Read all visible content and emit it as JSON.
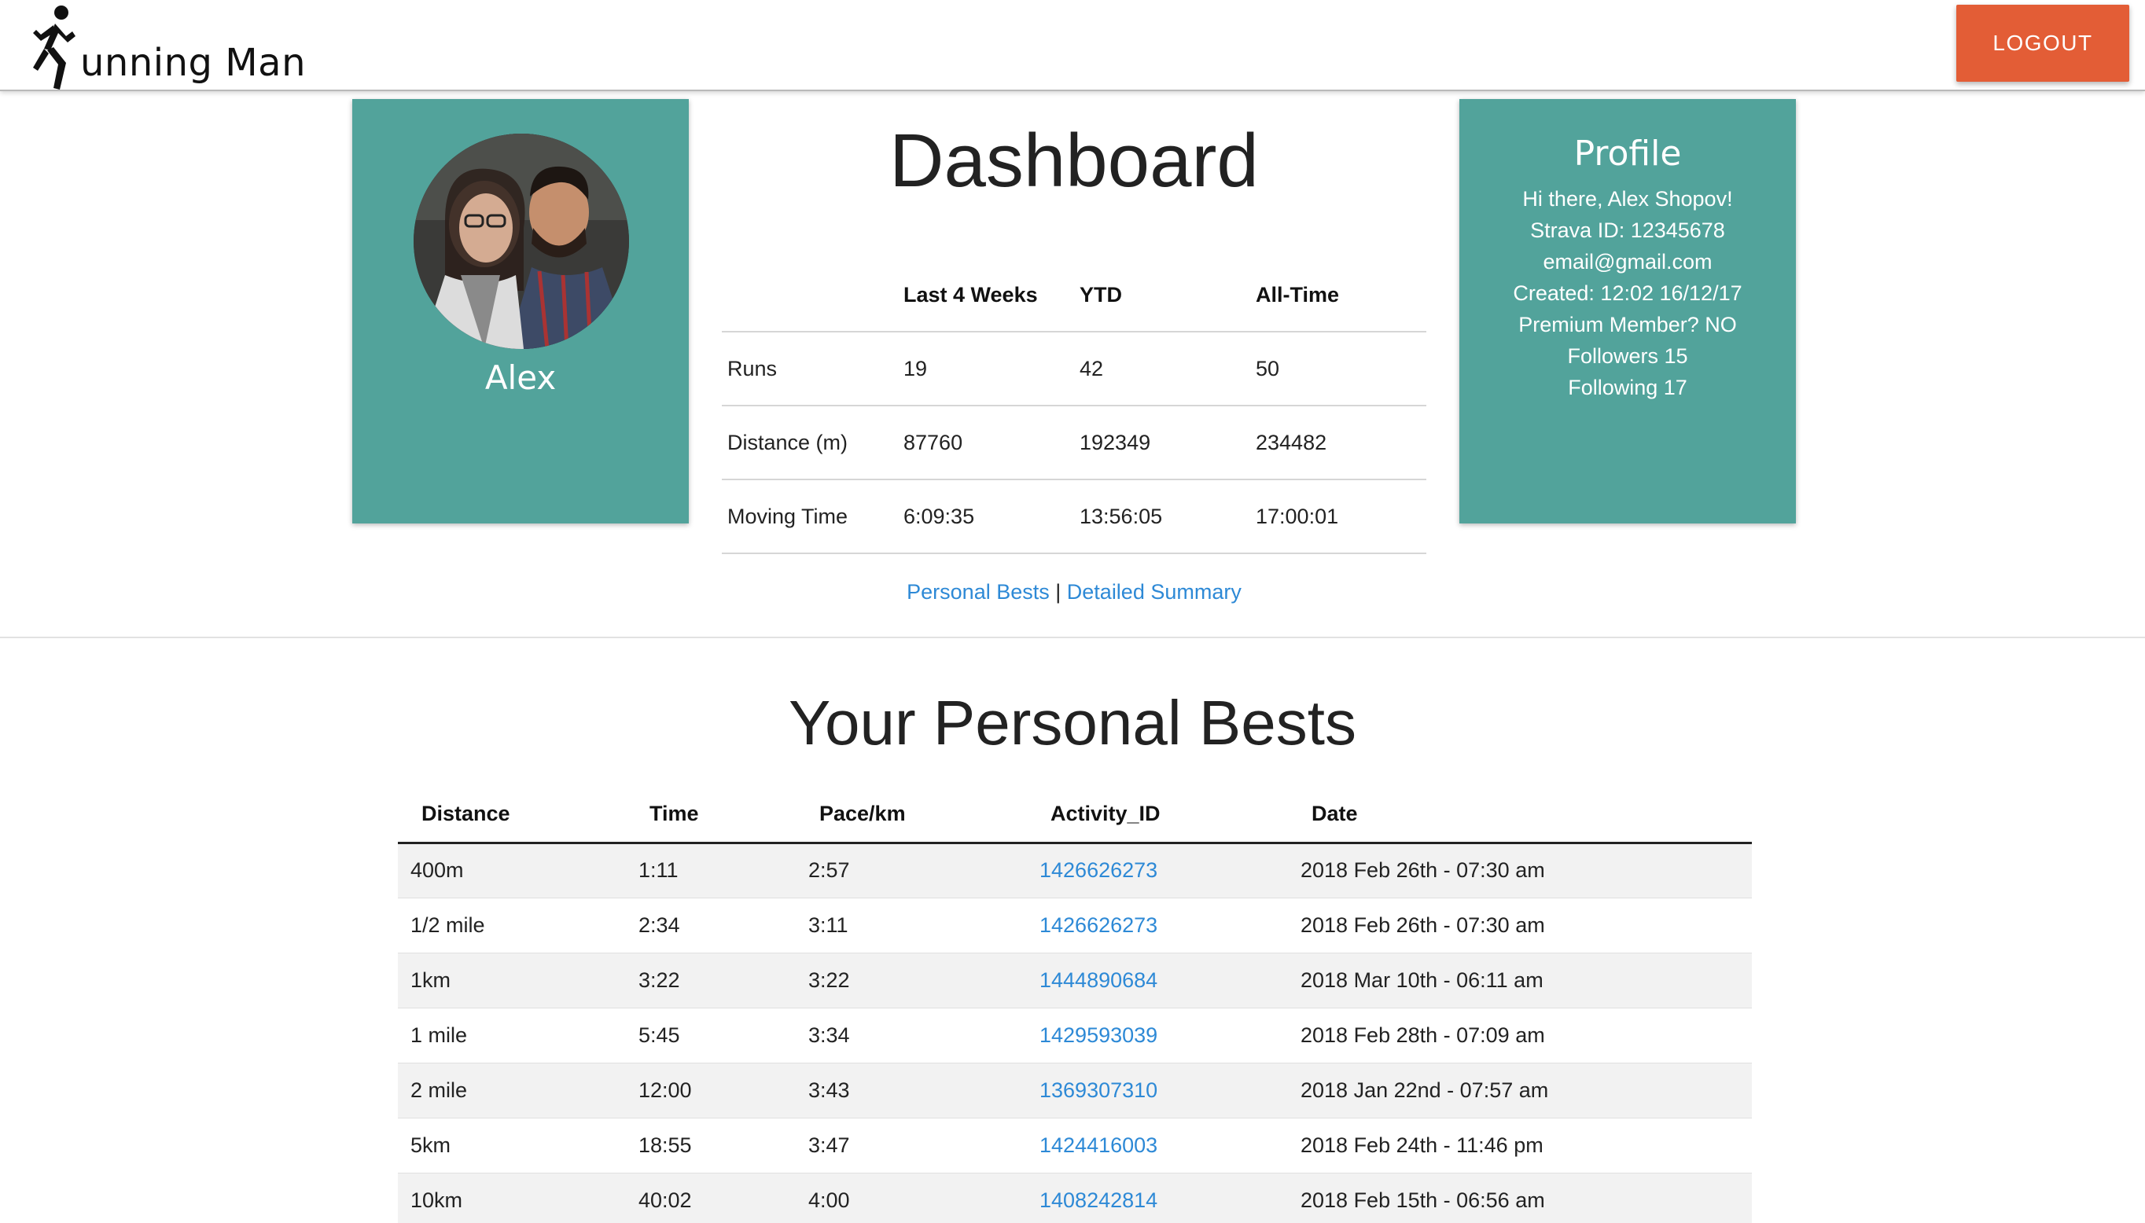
{
  "header": {
    "brand_text": "unning Man",
    "logout_label": "LOGOUT"
  },
  "user_card": {
    "name": "Alex",
    "color": "#52a39b"
  },
  "dashboard": {
    "title": "Dashboard",
    "columns": [
      "",
      "Last 4 Weeks",
      "YTD",
      "All-Time"
    ],
    "rows": [
      [
        "Runs",
        "19",
        "42",
        "50"
      ],
      [
        "Distance (m)",
        "87760",
        "192349",
        "234482"
      ],
      [
        "Moving Time",
        "6:09:35",
        "13:56:05",
        "17:00:01"
      ]
    ],
    "links": {
      "personal_bests": "Personal Bests",
      "separator": "|",
      "detailed_summary": "Detailed Summary"
    }
  },
  "profile": {
    "title": "Profile",
    "lines": [
      "Hi there, Alex Shopov!",
      "Strava ID: 12345678",
      "email@gmail.com",
      "Created: 12:02 16/12/17",
      "Premium Member? NO",
      "Followers 15",
      "Following 17"
    ]
  },
  "personal_bests": {
    "title": "Your Personal Bests",
    "columns": [
      "Distance",
      "Time",
      "Pace/km",
      "Activity_ID",
      "Date"
    ],
    "rows": [
      [
        "400m",
        "1:11",
        "2:57",
        "1426626273",
        "2018 Feb 26th - 07:30 am"
      ],
      [
        "1/2 mile",
        "2:34",
        "3:11",
        "1426626273",
        "2018 Feb 26th - 07:30 am"
      ],
      [
        "1km",
        "3:22",
        "3:22",
        "1444890684",
        "2018 Mar 10th - 06:11 am"
      ],
      [
        "1 mile",
        "5:45",
        "3:34",
        "1429593039",
        "2018 Feb 28th - 07:09 am"
      ],
      [
        "2 mile",
        "12:00",
        "3:43",
        "1369307310",
        "2018 Jan 22nd - 07:57 am"
      ],
      [
        "5km",
        "18:55",
        "3:47",
        "1424416003",
        "2018 Feb 24th - 11:46 pm"
      ],
      [
        "10km",
        "40:02",
        "4:00",
        "1408242814",
        "2018 Feb 15th - 06:56 am"
      ]
    ]
  },
  "colors": {
    "accent_teal": "#52a39b",
    "logout": "#e35d36",
    "link": "#2d89d6"
  },
  "icons": {
    "logo": "running-man-icon"
  }
}
